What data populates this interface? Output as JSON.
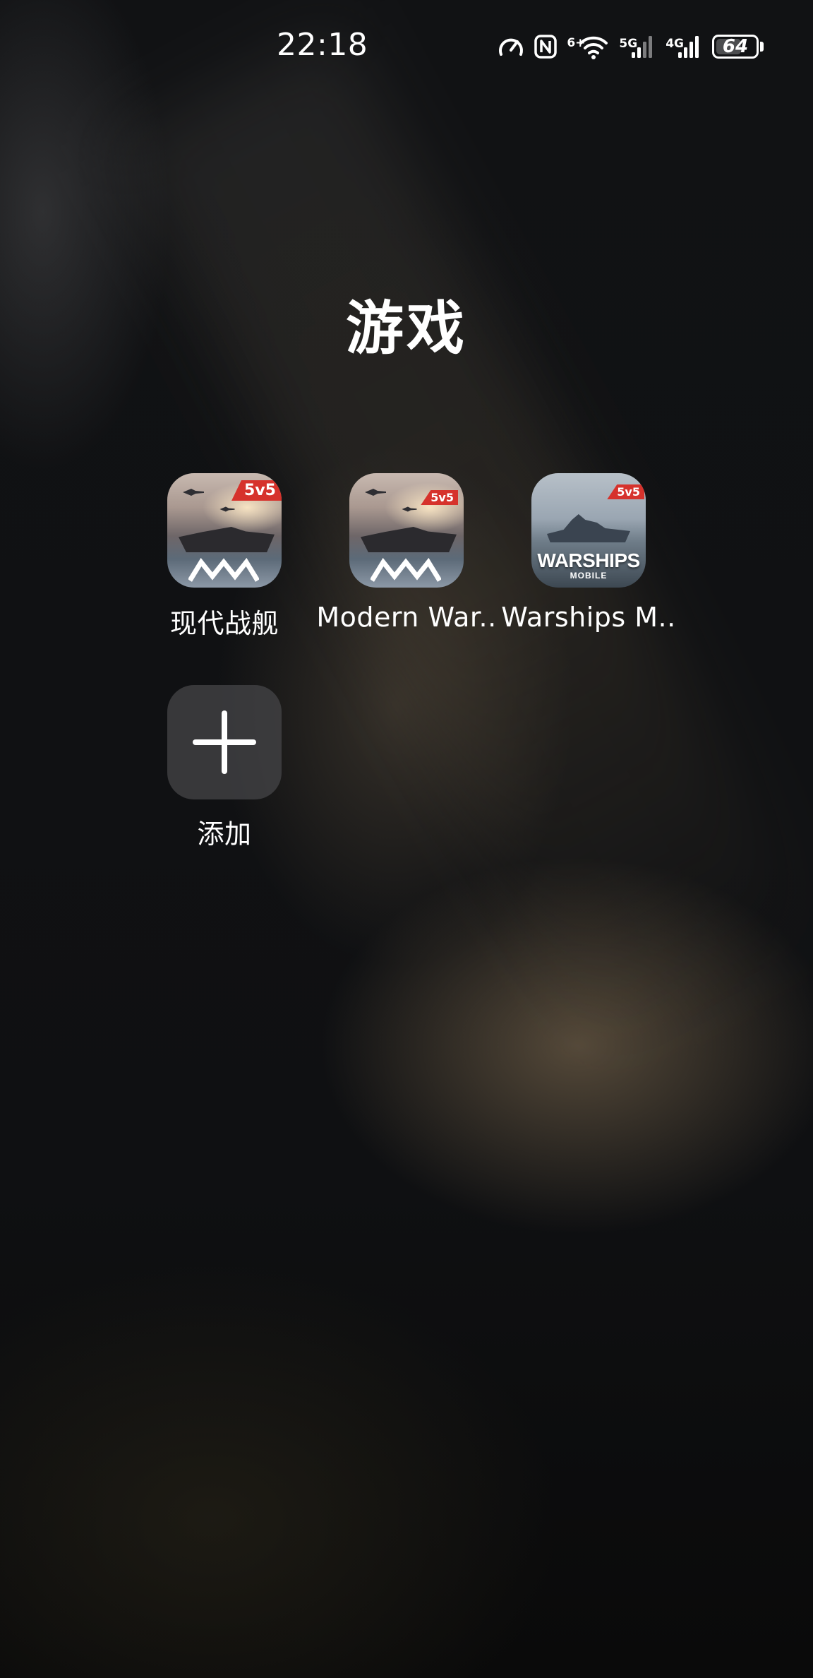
{
  "status_bar": {
    "time": "22:18",
    "icons": [
      "speedometer-icon",
      "nfc-icon",
      "wifi-icon",
      "signal-5g-icon",
      "signal-4g-icon",
      "battery-icon"
    ],
    "wifi_badge": "6+",
    "network_1": "5G",
    "network_2": "4G",
    "battery_level": "64"
  },
  "folder": {
    "title": "游戏"
  },
  "apps": [
    {
      "label": "现代战舰",
      "icon": "modern-warships-icon",
      "badge": "5v5"
    },
    {
      "label": "Modern War..",
      "icon": "modern-warships-icon",
      "badge": "5v5"
    },
    {
      "label": "Warships M..",
      "icon": "warships-mobile-icon",
      "badge": "5v5",
      "icon_text": "WARSHIPS",
      "icon_subtext": "MOBILE"
    }
  ],
  "add_button": {
    "label": "添加",
    "icon": "plus-icon"
  },
  "colors": {
    "badge": "#d6322c",
    "text": "#ffffff"
  }
}
